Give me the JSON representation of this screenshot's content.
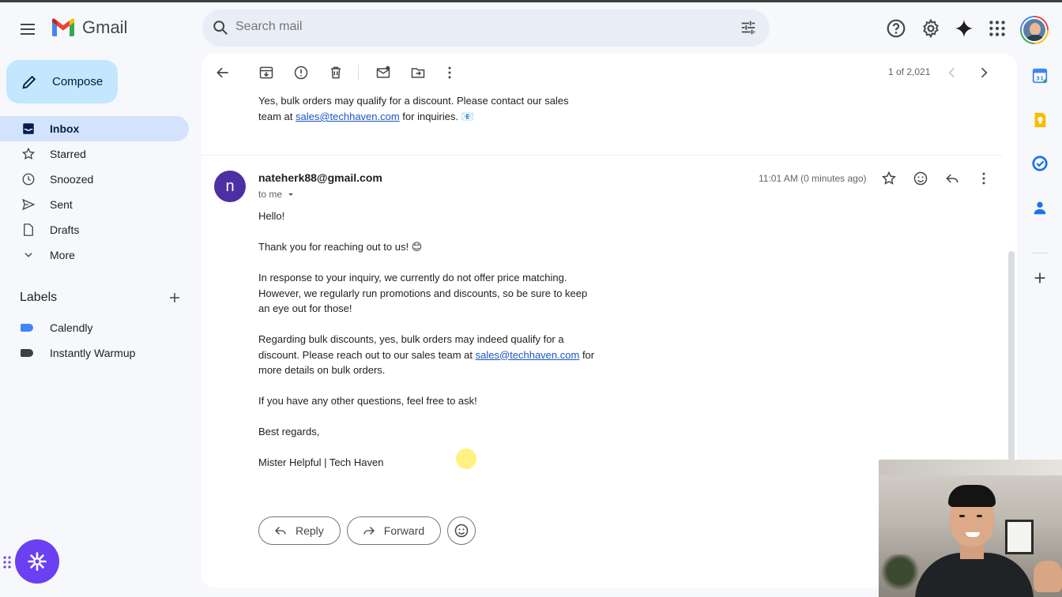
{
  "app": {
    "name": "Gmail"
  },
  "search": {
    "placeholder": "Search mail"
  },
  "compose": {
    "label": "Compose"
  },
  "nav": [
    {
      "label": "Inbox",
      "icon": "inbox-icon",
      "active": true
    },
    {
      "label": "Starred",
      "icon": "star-icon"
    },
    {
      "label": "Snoozed",
      "icon": "clock-icon"
    },
    {
      "label": "Sent",
      "icon": "send-icon"
    },
    {
      "label": "Drafts",
      "icon": "draft-icon"
    },
    {
      "label": "More",
      "icon": "chevron-down-icon"
    }
  ],
  "labels": {
    "title": "Labels",
    "items": [
      {
        "label": "Calendly",
        "color": "#4285f4"
      },
      {
        "label": "Instantly Warmup",
        "color": "#3c4043"
      }
    ]
  },
  "toolbar": {
    "count": "1 of 2,021"
  },
  "previous_message": {
    "text_before": "Yes, bulk orders may qualify for a discount. Please contact our sales team at ",
    "link": "sales@techhaven.com",
    "text_after": " for inquiries. 📧"
  },
  "message": {
    "avatar_letter": "n",
    "sender": "nateherk88@gmail.com",
    "to": "to me",
    "time": "11:01 AM (0 minutes ago)",
    "greeting": "Hello!",
    "p1": "Thank you for reaching out to us! 😊",
    "p2": "In response to your inquiry, we currently do not offer price matching. However, we regularly run promotions and discounts, so be sure to keep an eye out for those!",
    "p3_before": "Regarding bulk discounts, yes, bulk orders may indeed qualify for a discount. Please reach out to our sales team at ",
    "p3_link": "sales@techhaven.com",
    "p3_after": " for more details on bulk orders.",
    "p4": "If you have any other questions, feel free to ask!",
    "closing": "Best regards,",
    "signature": "Mister Helpful | Tech Haven"
  },
  "reply_bar": {
    "reply": "Reply",
    "forward": "Forward"
  },
  "colors": {
    "accent": "#0b57d0",
    "compose_bg": "#c2e7ff",
    "active_nav": "#d3e3fd",
    "fab": "#6b3ff2",
    "avatar": "#4b2fa3"
  }
}
